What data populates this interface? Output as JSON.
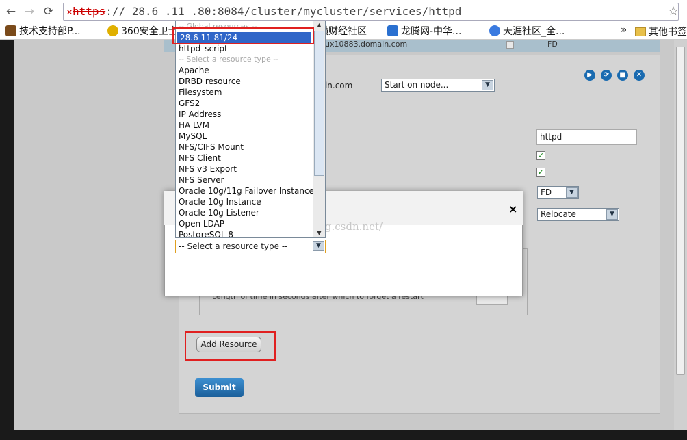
{
  "browser": {
    "url_scheme": "https",
    "url_rest": ":// 28.6 .11 .80:8084/cluster/mycluster/services/httpd",
    "url_host_part": "",
    "bookmarks": [
      {
        "label": "技术支持部P...",
        "icon": "page-icon",
        "color": "#7a4a1a"
      },
      {
        "label": "360安全卫士",
        "icon": "shield-plus-icon",
        "color": "#e0b000"
      },
      {
        "label": "横财经社区",
        "icon": "page-icon",
        "color": "#888888"
      },
      {
        "label": "龙腾网-中华...",
        "icon": "e-icon",
        "color": "#2a70d0"
      },
      {
        "label": "天涯社区_全...",
        "icon": "globe-icon",
        "color": "#3a7ae0"
      }
    ],
    "bookmarks_more": "»",
    "other_bookmarks": "其他书签"
  },
  "page": {
    "top_row": {
      "host": "ux10883.domain.com",
      "failover": "FD"
    },
    "domain_text": "nain.com",
    "start_select": "Start on node...",
    "name_value": "httpd",
    "failover_select": "FD",
    "recovery_select": "Relocate",
    "forget_text": "Length of time in seconds after which to forget a restart",
    "add_resource_label": "Add Resource",
    "submit_label": "Submit"
  },
  "modal": {
    "close_glyph": "×",
    "watermark": "http://blog.csdn.net/",
    "resource_select_value": "-- Select a resource type --"
  },
  "dropdown": {
    "options": [
      {
        "label": "-- Global resources --",
        "group": true
      },
      {
        "label": "28.6  11  81/24",
        "selected": true
      },
      {
        "label": "httpd_script"
      },
      {
        "label": "-- Select a resource type --",
        "group": true
      },
      {
        "label": "Apache"
      },
      {
        "label": "DRBD resource"
      },
      {
        "label": "Filesystem"
      },
      {
        "label": "GFS2"
      },
      {
        "label": "IP Address"
      },
      {
        "label": "HA LVM"
      },
      {
        "label": "MySQL"
      },
      {
        "label": "NFS/CIFS Mount"
      },
      {
        "label": "NFS Client"
      },
      {
        "label": "NFS v3 Export"
      },
      {
        "label": "NFS Server"
      },
      {
        "label": "Oracle 10g/11g Failover Instance"
      },
      {
        "label": "Oracle 10g Instance"
      },
      {
        "label": "Oracle 10g Listener"
      },
      {
        "label": "Open LDAP"
      },
      {
        "label": "PostgreSQL 8"
      }
    ]
  },
  "colors": {
    "accent": "#3066c8",
    "highlight": "#e02020",
    "submit": "#1b5f9a"
  }
}
